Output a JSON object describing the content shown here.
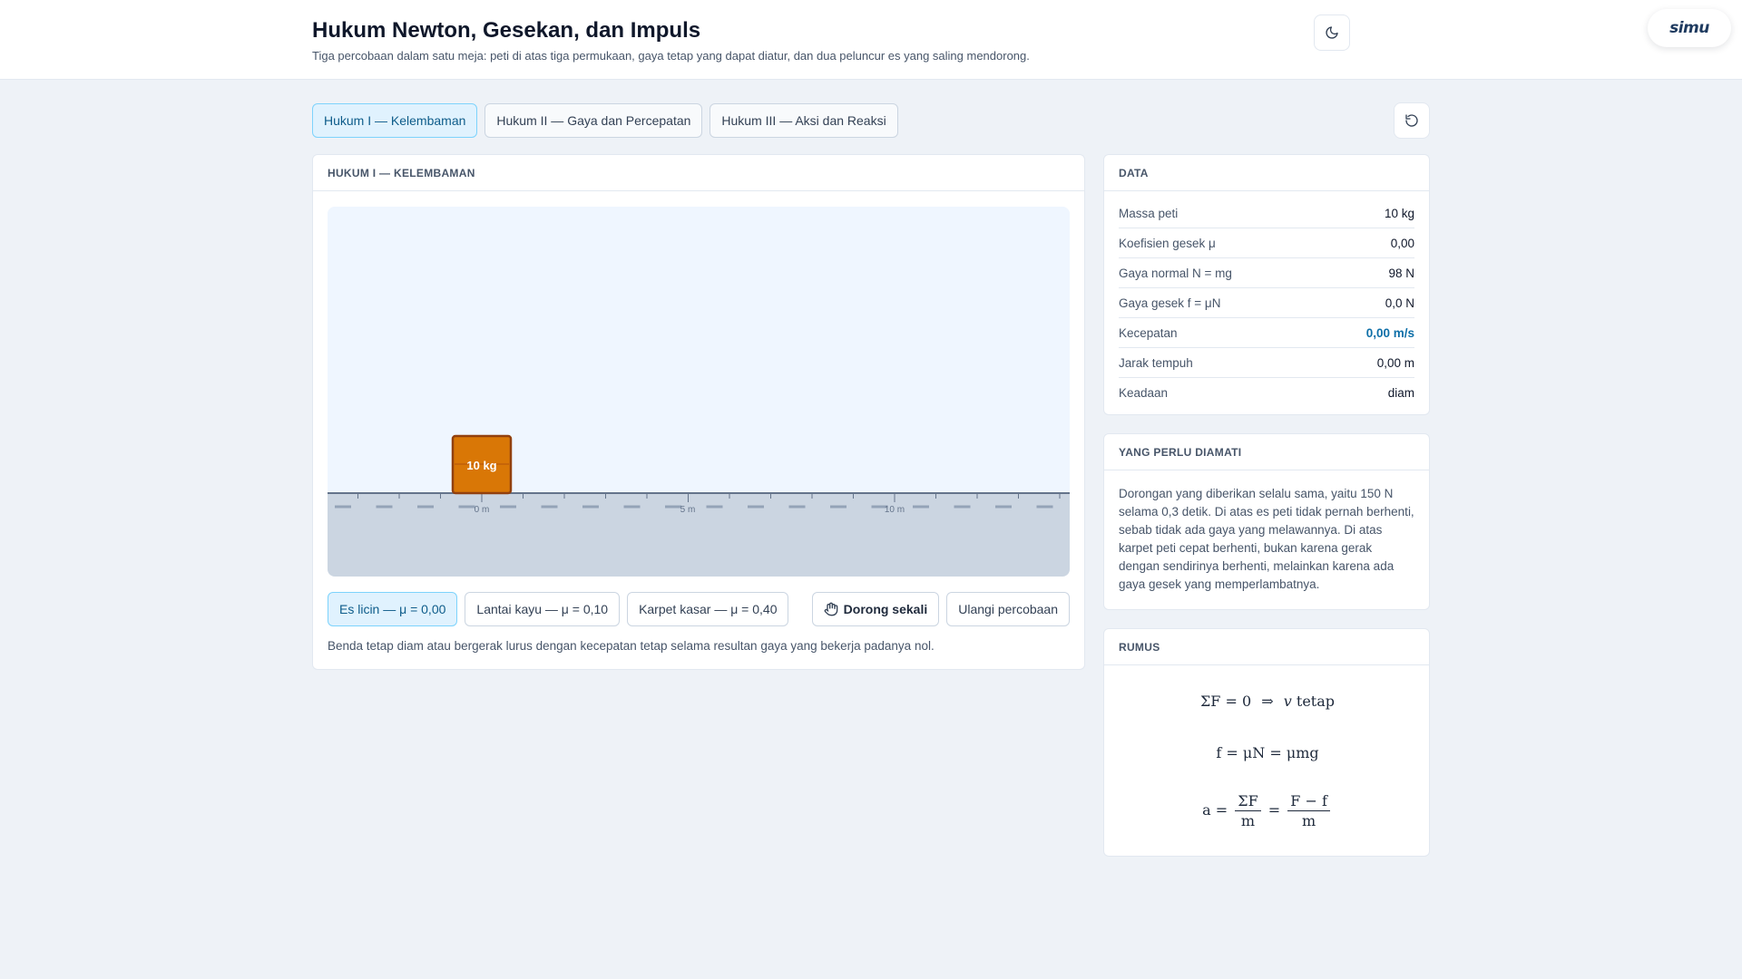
{
  "header": {
    "title": "Hukum Newton, Gesekan, dan Impuls",
    "subtitle": "Tiga percobaan dalam satu meja: peti di atas tiga permukaan, gaya tetap yang dapat diatur, dan dua peluncur es yang saling mendorong.",
    "logo_text": "simu",
    "theme_icon": "moon-icon"
  },
  "tabs": [
    {
      "label": "Hukum I — Kelembaman",
      "active": true
    },
    {
      "label": "Hukum II — Gaya dan Percepatan",
      "active": false
    },
    {
      "label": "Hukum III — Aksi dan Reaksi",
      "active": false
    }
  ],
  "main": {
    "heading": "HUKUM I — KELEMBAMAN",
    "crate_label": "10 kg",
    "ruler": [
      "0 m",
      "5 m",
      "10 m"
    ],
    "surfaces": [
      {
        "label": "Es licin — μ = 0,00",
        "active": true
      },
      {
        "label": "Lantai kayu — μ = 0,10",
        "active": false
      },
      {
        "label": "Karpet kasar — μ = 0,40",
        "active": false
      }
    ],
    "push_label": "Dorong sekali",
    "retry_label": "Ulangi percobaan",
    "caption": "Benda tetap diam atau bergerak lurus dengan kecepatan tetap selama resultan gaya yang bekerja padanya nol."
  },
  "data_panel": {
    "heading": "DATA",
    "rows": [
      {
        "label": "Massa peti",
        "value": "10 kg"
      },
      {
        "label": "Koefisien gesek μ",
        "value": "0,00"
      },
      {
        "label": "Gaya normal N = mg",
        "value": "98 N"
      },
      {
        "label": "Gaya gesek f = μN",
        "value": "0,0 N"
      },
      {
        "label": "Kecepatan",
        "value": "0,00 m/s"
      },
      {
        "label": "Jarak tempuh",
        "value": "0,00 m"
      },
      {
        "label": "Keadaan",
        "value": "diam"
      }
    ]
  },
  "observe_panel": {
    "heading": "YANG PERLU DIAMATI",
    "text": "Dorongan yang diberikan selalu sama, yaitu 150 N selama 0,3 detik. Di atas es peti tidak pernah berhenti, sebab tidak ada gaya yang melawannya. Di atas karpet peti cepat berhenti, bukan karena gerak dengan sendirinya berhenti, melainkan karena ada gaya gesek yang memperlambatnya."
  },
  "formula_panel": {
    "heading": "RUMUS",
    "f1": {
      "lhs": "ΣF = 0",
      "arrow": "⇒",
      "rhs": "v",
      "word": "tetap"
    },
    "f2": "f = μN = μmg",
    "f3": {
      "lhs": "a =",
      "n1": "ΣF",
      "d1": "m",
      "eq": "=",
      "n2": "F − f",
      "d2": "m"
    }
  },
  "colors": {
    "accent": "#0e6fa8",
    "crate": "#d97706",
    "crate_border": "#92400e",
    "ground": "#cbd5e1",
    "sky": "#eff6ff"
  }
}
